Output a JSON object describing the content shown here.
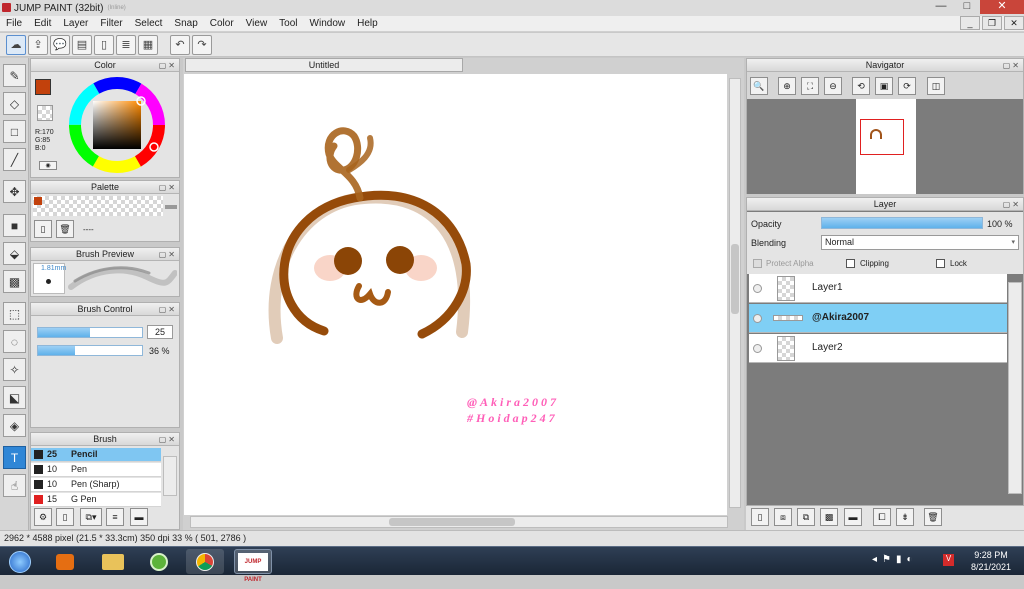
{
  "app": {
    "title": "JUMP PAINT (32bit)",
    "subtitle": "(Inline)"
  },
  "menu": [
    "File",
    "Edit",
    "Layer",
    "Filter",
    "Select",
    "Snap",
    "Color",
    "View",
    "Tool",
    "Window",
    "Help"
  ],
  "window_controls": {
    "minimize": "—",
    "maximize": "□",
    "close": "✕"
  },
  "color_panel": {
    "title": "Color",
    "main_color": "#c2410c",
    "r_label": "R:170",
    "g_label": "G:85",
    "b_label": "B:0"
  },
  "palette_panel": {
    "title": "Palette",
    "none_label": "----"
  },
  "brush_preview": {
    "title": "Brush Preview",
    "size_label": "1.81mm"
  },
  "brush_control": {
    "title": "Brush Control",
    "size_value": "25",
    "opacity_value": "36 %",
    "size_fraction": 0.5,
    "opacity_fraction": 0.36
  },
  "brush_panel": {
    "title": "Brush",
    "items": [
      {
        "size": "25",
        "name": "Pencil",
        "color": "#222222",
        "selected": true
      },
      {
        "size": "10",
        "name": "Pen",
        "color": "#222222",
        "selected": false
      },
      {
        "size": "10",
        "name": "Pen (Sharp)",
        "color": "#222222",
        "selected": false
      },
      {
        "size": "15",
        "name": "G Pen",
        "color": "#e02020",
        "selected": false
      }
    ]
  },
  "document": {
    "tab": "Untitled",
    "watermark_1": "@Akira2007",
    "watermark_2": "#Hoidap247"
  },
  "navigator": {
    "title": "Navigator"
  },
  "layer_panel": {
    "title": "Layer",
    "opacity_label": "Opacity",
    "opacity_value": "100 %",
    "opacity_fraction": 1.0,
    "blending_label": "Blending",
    "blending_value": "Normal",
    "protect_alpha": "Protect Alpha",
    "clipping": "Clipping",
    "lock": "Lock",
    "layers": [
      {
        "name": "Layer1",
        "selected": false
      },
      {
        "name": "@Akira2007",
        "selected": true
      },
      {
        "name": "Layer2",
        "selected": false
      }
    ]
  },
  "status": {
    "text": "2962 * 4588 pixel   (21.5 * 33.3cm)   350 dpi   33 %   ( 501, 2786 )"
  },
  "taskbar": {
    "time": "9:28 PM",
    "date": "8/21/2021",
    "paint_label": "JUMP PAINT"
  }
}
